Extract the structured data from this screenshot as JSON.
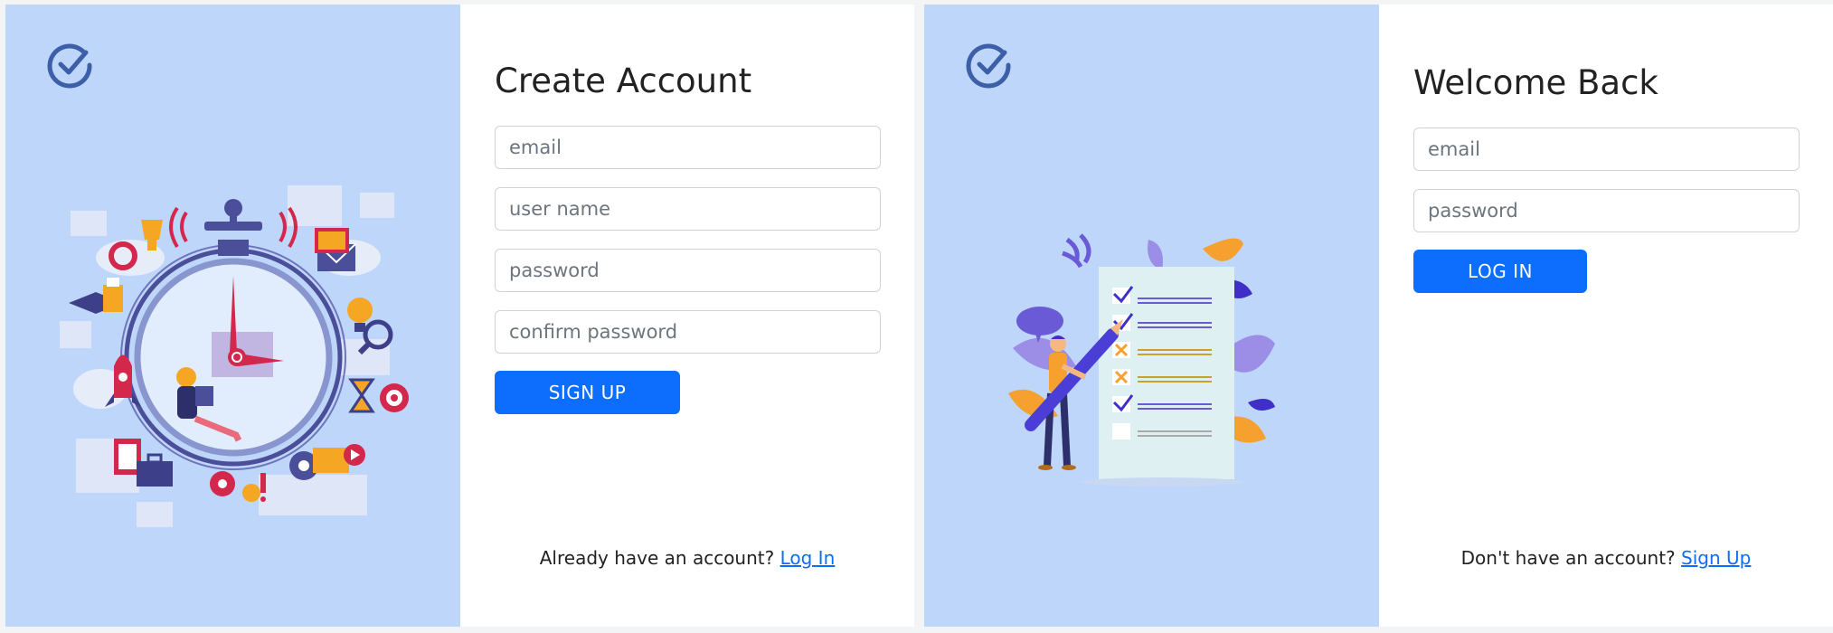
{
  "signup": {
    "title": "Create Account",
    "fields": {
      "email": "email",
      "username": "user name",
      "password": "password",
      "confirm": "confirm password"
    },
    "submit_label": "SIGN UP",
    "switch_prompt": "Already have an account?",
    "switch_link": "Log In"
  },
  "login": {
    "title": "Welcome Back",
    "fields": {
      "email": "email",
      "password": "password"
    },
    "submit_label": "LOG IN",
    "switch_prompt": "Don't have an account?",
    "switch_link": "Sign Up"
  },
  "colors": {
    "art_background": "#bed6f9",
    "primary": "#0d6efd",
    "logo": "#3d5fa8"
  },
  "icons": {
    "logo": "check-circle-icon"
  }
}
